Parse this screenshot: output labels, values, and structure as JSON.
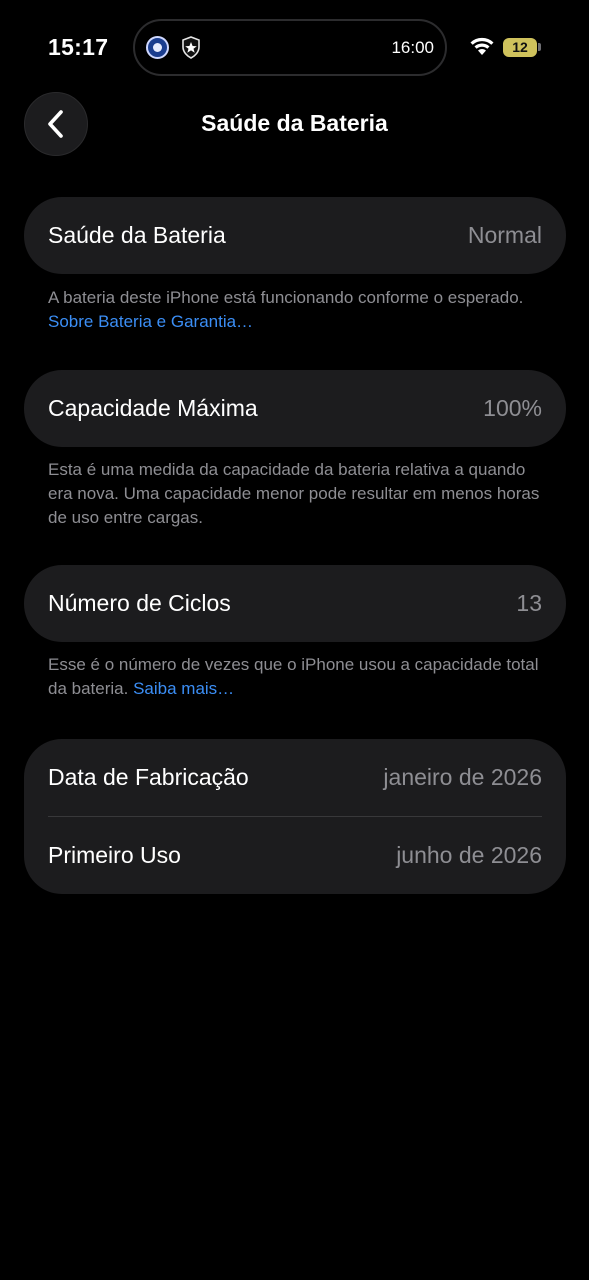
{
  "status_bar": {
    "time": "15:17",
    "island_time": "16:00",
    "battery_level": "12",
    "icons": [
      "team-crest-icon",
      "shield-star-icon",
      "wifi-icon",
      "battery-icon"
    ]
  },
  "nav": {
    "back_icon": "chevron-left-icon",
    "title": "Saúde da Bateria"
  },
  "battery_health": {
    "label": "Saúde da Bateria",
    "value": "Normal",
    "footnote": "A bateria deste iPhone está funcionando conforme o esperado.",
    "footnote_link": "Sobre Bateria e Garantia…"
  },
  "max_capacity": {
    "label": "Capacidade Máxima",
    "value": "100%",
    "footnote": "Esta é uma medida da capacidade da bateria relativa a quando era nova. Uma capacidade menor pode resultar em menos horas de uso entre cargas."
  },
  "cycle_count": {
    "label": "Número de Ciclos",
    "value": "13",
    "footnote": "Esse é o número de vezes que o iPhone usou a capacidade total da bateria.",
    "footnote_link": "Saiba mais…"
  },
  "dates": {
    "manufacture_label": "Data de Fabricação",
    "manufacture_value": "janeiro de 2026",
    "first_use_label": "Primeiro Uso",
    "first_use_value": "junho de 2026"
  },
  "colors": {
    "background": "#000000",
    "cell": "#1c1c1e",
    "secondary_text": "#8e8e93",
    "link": "#3b8ef5",
    "battery": "#cfc25c"
  }
}
